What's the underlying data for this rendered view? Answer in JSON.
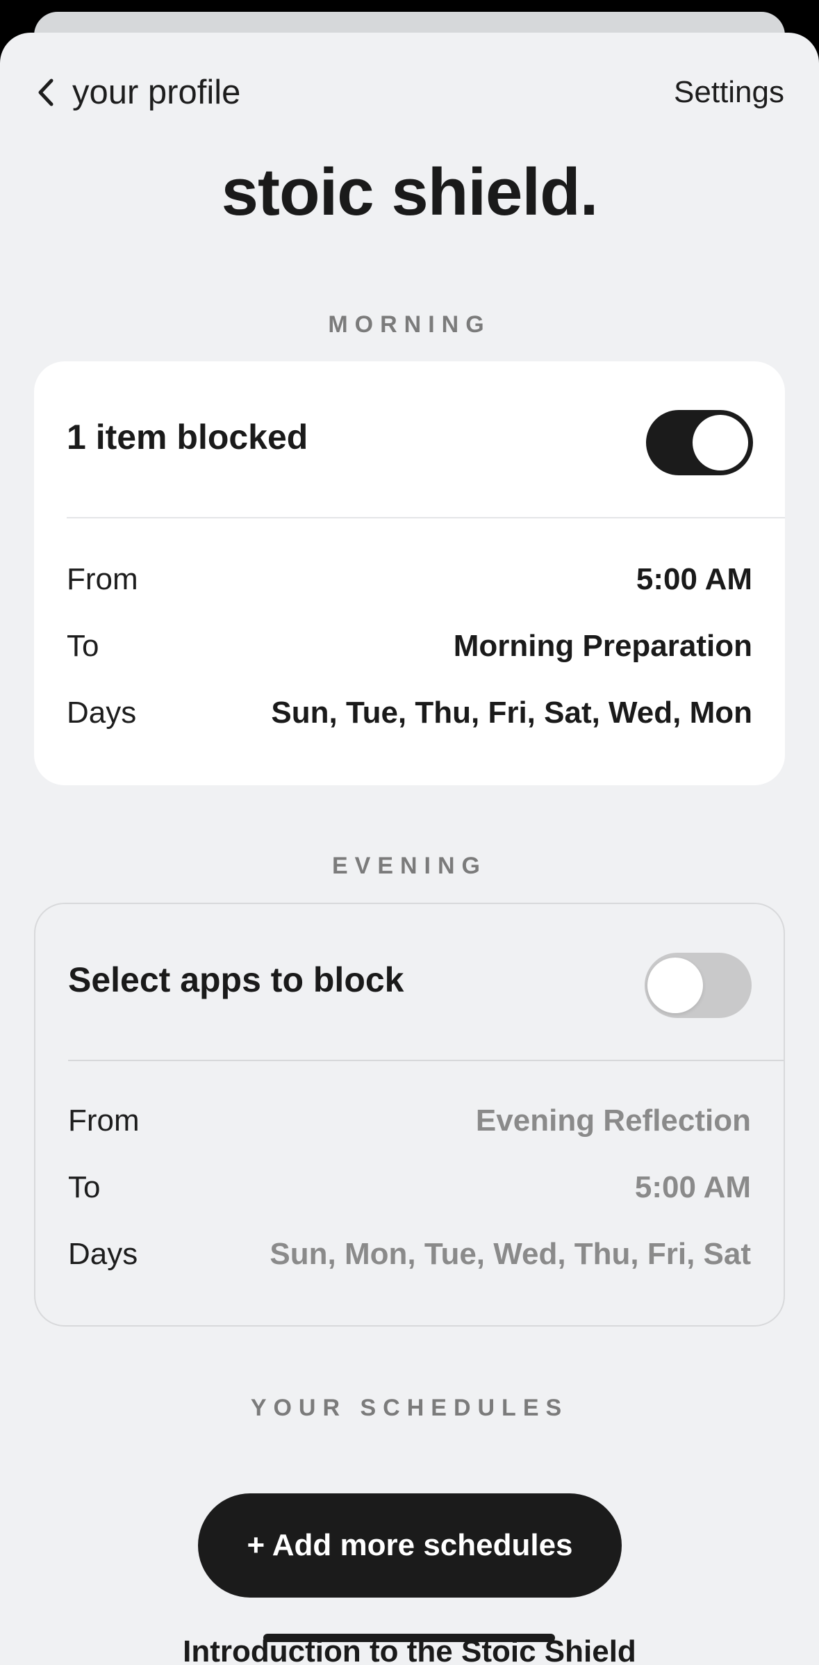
{
  "nav": {
    "back_label": "your profile",
    "settings_label": "Settings"
  },
  "title": "stoic shield.",
  "morning": {
    "section_label": "MORNING",
    "header": "1 item blocked",
    "toggle_on": true,
    "rows": [
      {
        "label": "From",
        "value": "5:00 AM"
      },
      {
        "label": "To",
        "value": "Morning Preparation"
      },
      {
        "label": "Days",
        "value": "Sun, Tue, Thu, Fri, Sat, Wed, Mon"
      }
    ]
  },
  "evening": {
    "section_label": "EVENING",
    "header": "Select apps to block",
    "toggle_on": false,
    "rows": [
      {
        "label": "From",
        "value": "Evening Reflection"
      },
      {
        "label": "To",
        "value": "5:00 AM"
      },
      {
        "label": "Days",
        "value": "Sun, Mon, Tue, Wed, Thu, Fri, Sat"
      }
    ]
  },
  "schedules": {
    "section_label": "YOUR SCHEDULES",
    "add_button_label": "+ Add more schedules"
  },
  "intro_link": "Introduction to the Stoic Shield",
  "colors": {
    "background": "#f0f1f3",
    "primary_dark": "#1b1b1b",
    "muted_text": "#8a8a8a",
    "section_label": "#7b7b7b"
  },
  "icons": {
    "back": "chevron-left-icon"
  }
}
